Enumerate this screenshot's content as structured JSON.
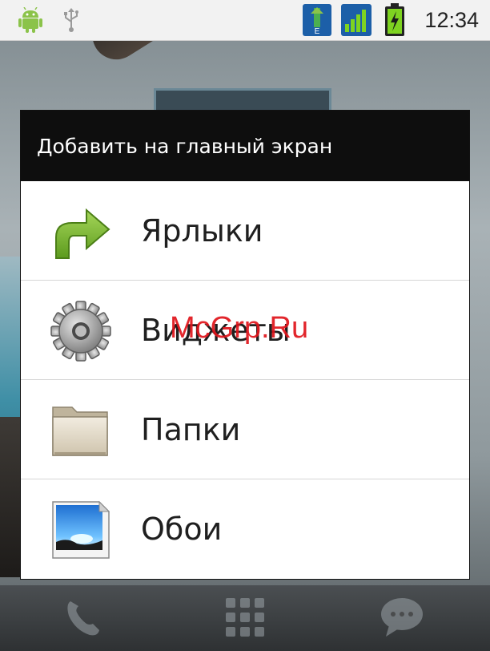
{
  "status_bar": {
    "time": "12:34",
    "icons": [
      "android-debug-icon",
      "usb-icon",
      "edge-network-icon",
      "signal-icon",
      "battery-charging-icon"
    ],
    "network_letter": "E"
  },
  "dialog": {
    "title": "Добавить на главный экран",
    "items": [
      {
        "label": "Ярлыки",
        "icon": "shortcut-arrow-icon"
      },
      {
        "label": "Виджеты",
        "icon": "gear-icon"
      },
      {
        "label": "Папки",
        "icon": "folder-icon"
      },
      {
        "label": "Обои",
        "icon": "wallpaper-icon"
      }
    ]
  },
  "dock": {
    "icons": [
      "phone-icon",
      "app-drawer-icon",
      "messaging-icon"
    ]
  },
  "watermark": "McGrp.Ru",
  "colors": {
    "dialog_header": "#0e0e0e",
    "watermark": "#e0141b",
    "battery_green": "#7ed321",
    "status_blue": "#1c5fa8"
  }
}
